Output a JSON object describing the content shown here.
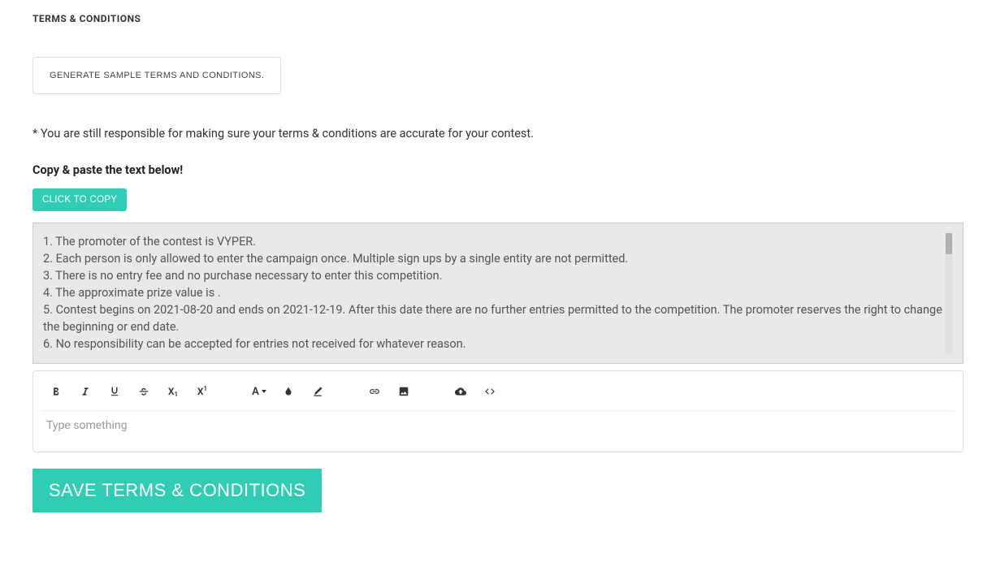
{
  "heading": "TERMS & CONDITIONS",
  "generate_button": "GENERATE SAMPLE TERMS AND CONDITIONS.",
  "disclaimer": "* You are still responsible for making sure your terms & conditions are accurate for your contest.",
  "copy_heading": "Copy & paste the text below!",
  "copy_button": "CLICK TO COPY",
  "terms_lines": [
    "1. The promoter of the contest is VYPER.",
    "2. Each person is only allowed to enter the campaign once. Multiple sign ups by a single entity are not permitted.",
    "3. There is no entry fee and no purchase necessary to enter this competition.",
    "4. The approximate prize value is .",
    "5. Contest begins on 2021-08-20 and ends on 2021-12-19. After this date there are no further entries permitted to the competition. The promoter reserves the right to change the beginning or end date.",
    "6. No responsibility can be accepted for entries not received for whatever reason."
  ],
  "editor_placeholder": "Type something",
  "save_button": "SAVE TERMS & CONDITIONS",
  "accent_color": "#2ecdb4"
}
